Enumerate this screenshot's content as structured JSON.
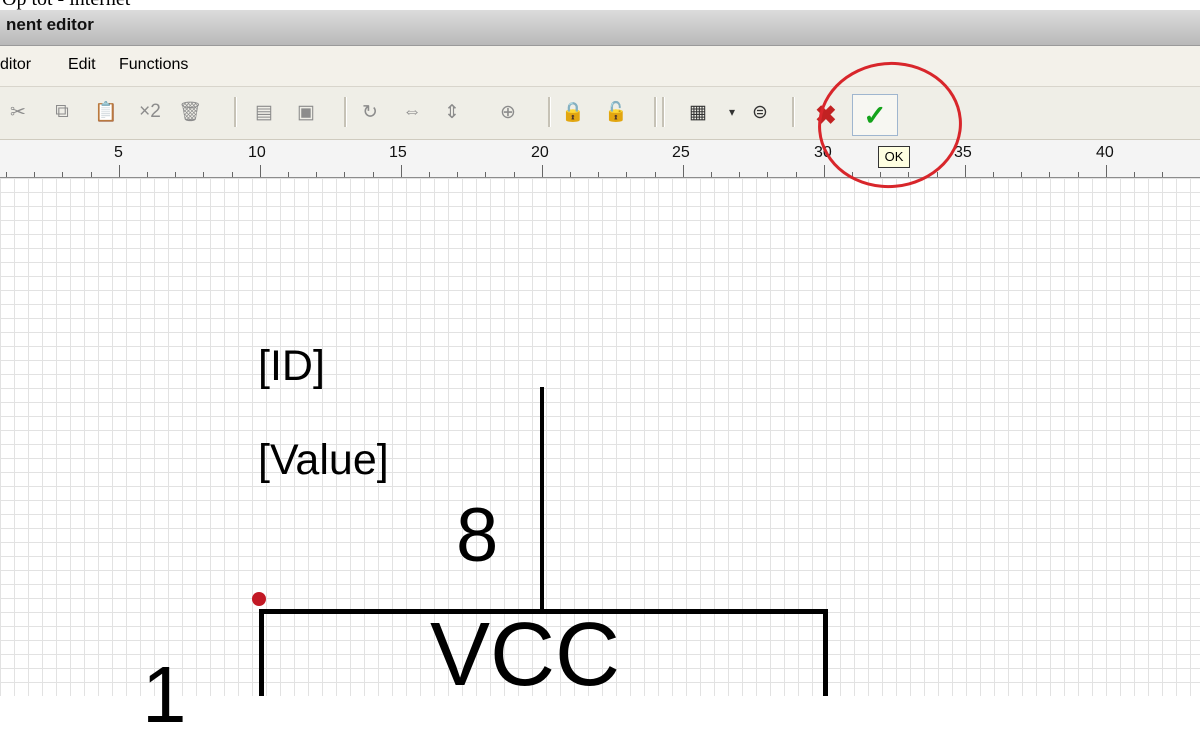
{
  "top_strip": "Op tot - internet",
  "window": {
    "title": "nent editor"
  },
  "menu": [
    "ditor",
    "Edit",
    "Functions"
  ],
  "toolbar": {
    "icons": [
      "cut-icon",
      "copy-icon",
      "paste-icon",
      "duplicate-icon",
      "delete-icon",
      "move-back-icon",
      "move-front-icon",
      "rotate-icon",
      "mirror-horizontal-icon",
      "mirror-vertical-icon",
      "pin-icon",
      "lock-icon",
      "unlock-icon",
      "grid-icon",
      "zoom-icon",
      "cancel-icon",
      "ok-icon"
    ],
    "duplicate_label": "×2",
    "ok_tooltip": "OK"
  },
  "ruler": {
    "labels": [
      "5",
      "10",
      "15",
      "20",
      "25",
      "30",
      "35",
      "40"
    ]
  },
  "schematic": {
    "id_label": "[ID]",
    "value_label": "[Value]",
    "pin_top": "8",
    "body_label": "VCC",
    "pin_left": "1"
  },
  "colors": {
    "ok_green": "#14a31b",
    "cancel_red": "#c22222",
    "highlight_red": "#d8262b",
    "anchor_dot": "#c21925"
  }
}
